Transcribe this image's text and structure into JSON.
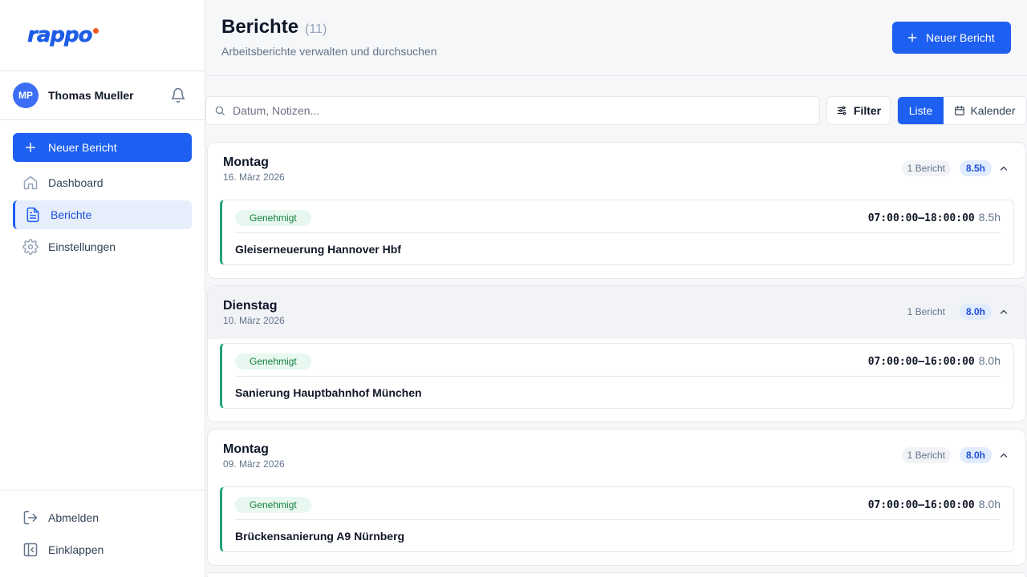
{
  "brand": {
    "logo_text": "rappo",
    "accent": "#1d5ff0",
    "dot_color": "#f05a22"
  },
  "user": {
    "initials": "MP",
    "name": "Thomas Mueller"
  },
  "sidebar": {
    "new_report_label": "Neuer Bericht",
    "items": [
      {
        "label": "Dashboard",
        "icon": "home-icon",
        "active": false
      },
      {
        "label": "Berichte",
        "icon": "file-text-icon",
        "active": true
      },
      {
        "label": "Einstellungen",
        "icon": "gear-icon",
        "active": false
      }
    ],
    "bottom": [
      {
        "label": "Abmelden",
        "icon": "logout-icon"
      },
      {
        "label": "Einklappen",
        "icon": "collapse-icon"
      }
    ]
  },
  "header": {
    "title": "Berichte",
    "count": "(11)",
    "subtitle": "Arbeitsberichte verwalten und durchsuchen",
    "new_report_label": "Neuer Bericht"
  },
  "toolbar": {
    "search_placeholder": "Datum, Notizen...",
    "filter_label": "Filter",
    "view_list_label": "Liste",
    "view_calendar_label": "Kalender",
    "active_view": "Liste"
  },
  "days": [
    {
      "weekday": "Montag",
      "date": "16. März 2026",
      "count_label": "1 Bericht",
      "hours": "8.5h",
      "reports": [
        {
          "status": "Genehmigt",
          "time_range": "07:00:00–18:00:00",
          "hours": "8.5h",
          "project": "Gleiserneuerung Hannover Hbf"
        }
      ]
    },
    {
      "weekday": "Dienstag",
      "date": "10. März 2026",
      "count_label": "1 Bericht",
      "hours": "8.0h",
      "reports": [
        {
          "status": "Genehmigt",
          "time_range": "07:00:00–16:00:00",
          "hours": "8.0h",
          "project": "Sanierung Hauptbahnhof München"
        }
      ]
    },
    {
      "weekday": "Montag",
      "date": "09. März 2026",
      "count_label": "1 Bericht",
      "hours": "8.0h",
      "reports": [
        {
          "status": "Genehmigt",
          "time_range": "07:00:00–16:00:00",
          "hours": "8.0h",
          "project": "Brückensanierung A9 Nürnberg"
        }
      ]
    }
  ]
}
